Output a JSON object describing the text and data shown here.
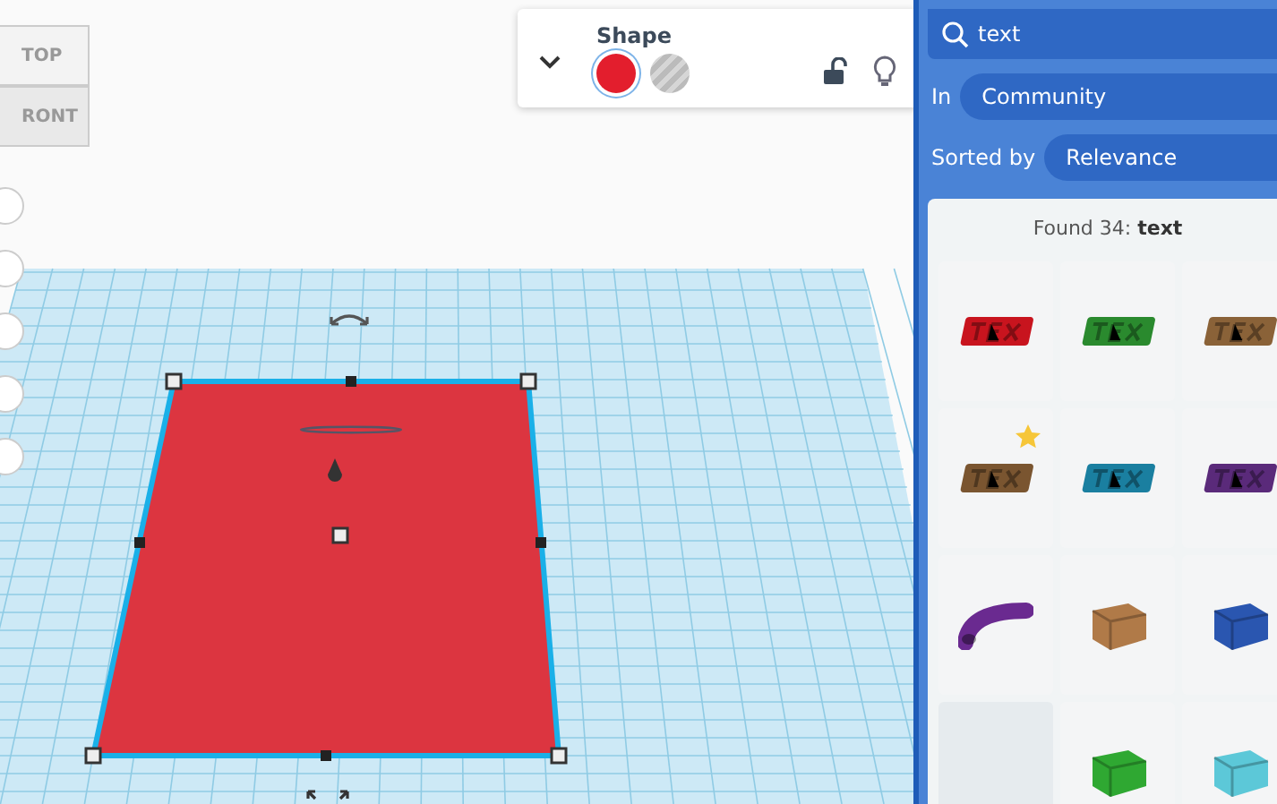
{
  "viewcube": {
    "faces": [
      "TOP",
      "RONT"
    ]
  },
  "shape_panel": {
    "title": "Shape",
    "swatches": [
      {
        "kind": "solid",
        "color": "#e31e2d",
        "selected": true
      },
      {
        "kind": "hole",
        "selected": false
      }
    ],
    "locked": false
  },
  "search": {
    "value": "text"
  },
  "filters": [
    {
      "label": "In",
      "value": "Community"
    },
    {
      "label": "Sorted by",
      "value": "Relevance"
    }
  ],
  "results": {
    "summary": "Found 34: **text**",
    "items": [
      {
        "kind": "text",
        "color": "#c8141e",
        "favorite": false
      },
      {
        "kind": "text",
        "color": "#2a8a2e",
        "favorite": false
      },
      {
        "kind": "text",
        "color": "#8a6238",
        "favorite": false
      },
      {
        "kind": "text",
        "color": "#7a5530",
        "favorite": true
      },
      {
        "kind": "text",
        "color": "#1a7fa0",
        "favorite": false
      },
      {
        "kind": "text",
        "color": "#5a2a7a",
        "favorite": false
      },
      {
        "kind": "tube",
        "color": "#6a2a90",
        "favorite": false
      },
      {
        "kind": "letter",
        "color": "#b07a48",
        "favorite": false
      },
      {
        "kind": "letter",
        "color": "#2a56b0",
        "favorite": false
      },
      {
        "kind": "empty",
        "color": "#e6ebee",
        "favorite": false
      },
      {
        "kind": "letter",
        "color": "#2fa832",
        "favorite": false
      },
      {
        "kind": "letter",
        "color": "#5cc8d8",
        "favorite": false
      }
    ]
  }
}
